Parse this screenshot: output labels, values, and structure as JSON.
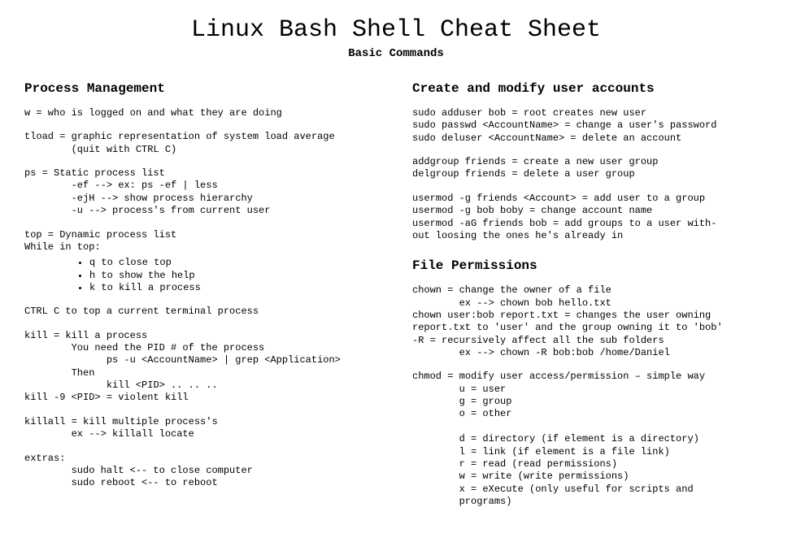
{
  "title": "Linux Bash Shell Cheat Sheet",
  "subtitle": "Basic Commands",
  "left": {
    "heading": "Process Management",
    "b1": "w = who is logged on and what they are doing",
    "b2": "tload = graphic representation of system load average\n        (quit with CTRL C)",
    "b3": "ps = Static process list\n        -ef --> ex: ps -ef | less\n        -ejH --> show process hierarchy\n        -u --> process's from current user",
    "b4": "top = Dynamic process list\nWhile in top:",
    "bullets": [
      "q to close top",
      "h to show the help",
      "k to kill a process"
    ],
    "b5": "CTRL C to top a current terminal process",
    "b6": "kill = kill a process\n        You need the PID # of the process\n              ps -u <AccountName> | grep <Application>\n        Then\n              kill <PID> .. .. ..\nkill -9 <PID> = violent kill",
    "b7": "killall = kill multiple process's\n        ex --> killall locate",
    "b8": "extras:\n        sudo halt <-- to close computer\n        sudo reboot <-- to reboot"
  },
  "right": {
    "heading1": "Create and modify user accounts",
    "r1": "sudo adduser bob = root creates new user\nsudo passwd <AccountName> = change a user's password\nsudo deluser <AccountName> = delete an account",
    "r2": "addgroup friends = create a new user group\ndelgroup friends = delete a user group",
    "r3": "usermod -g friends <Account> = add user to a group\nusermod -g bob boby = change account name\nusermod -aG friends bob = add groups to a user with-\nout loosing the ones he's already in",
    "heading2": "File Permissions",
    "r4": "chown = change the owner of a file\n        ex --> chown bob hello.txt\nchown user:bob report.txt = changes the user owning\nreport.txt to 'user' and the group owning it to 'bob'\n-R = recursively affect all the sub folders\n        ex --> chown -R bob:bob /home/Daniel",
    "r5": "chmod = modify user access/permission – simple way\n        u = user\n        g = group\n        o = other\n\n        d = directory (if element is a directory)\n        l = link (if element is a file link)\n        r = read (read permissions)\n        w = write (write permissions)\n        x = eXecute (only useful for scripts and\n        programs)"
  }
}
